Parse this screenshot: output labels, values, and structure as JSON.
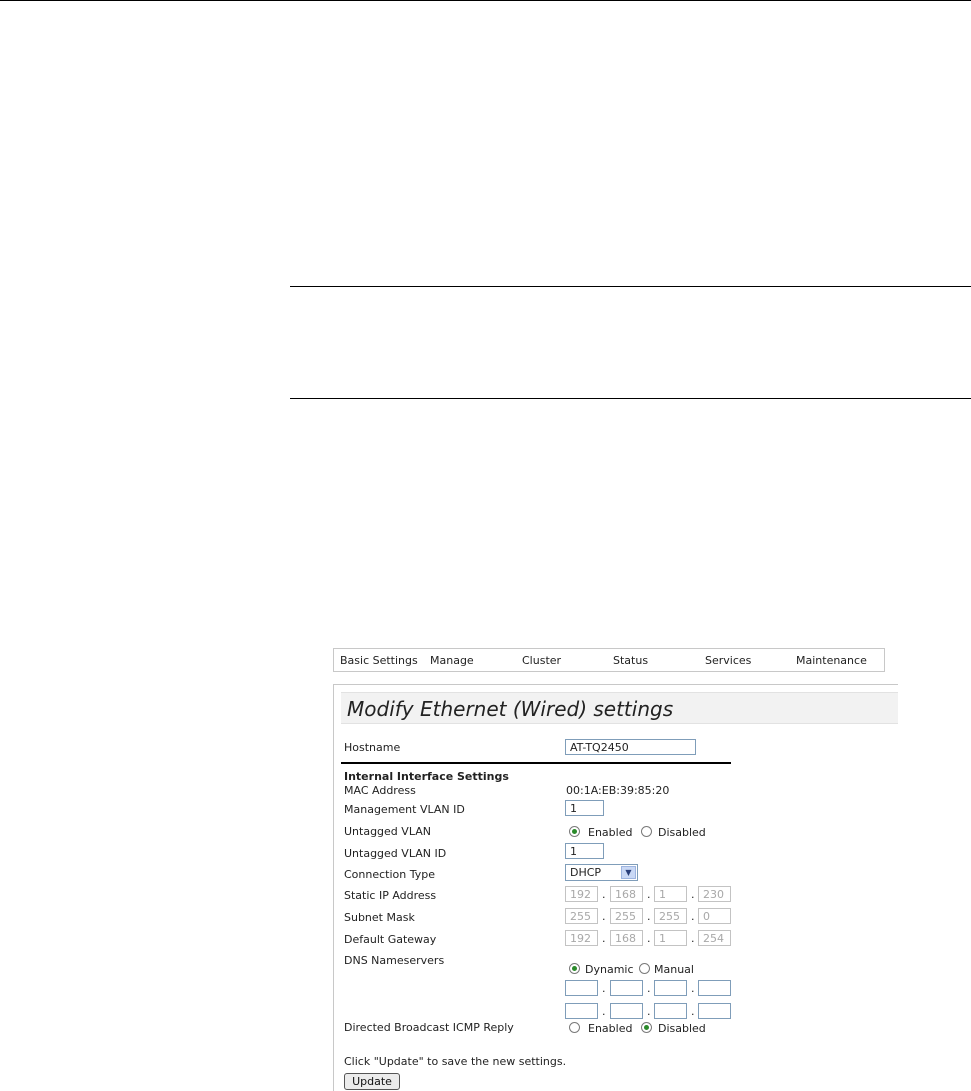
{
  "menu": {
    "items": [
      "Basic Settings",
      "Manage",
      "Cluster",
      "Status",
      "Services",
      "Maintenance"
    ]
  },
  "page": {
    "title": "Modify Ethernet (Wired) settings"
  },
  "form": {
    "hostname_label": "Hostname",
    "hostname_value": "AT-TQ2450",
    "section_heading": "Internal Interface Settings",
    "mac_label": "MAC Address",
    "mac_value": "00:1A:EB:39:85:20",
    "mgmt_vlan_label": "Management VLAN ID",
    "mgmt_vlan_value": "1",
    "untagged_vlan_label": "Untagged VLAN",
    "untagged_vlan_options": [
      "Enabled",
      "Disabled"
    ],
    "untagged_vlan_selected": "Enabled",
    "untagged_vlan_id_label": "Untagged VLAN ID",
    "untagged_vlan_id_value": "1",
    "connection_type_label": "Connection Type",
    "connection_type_value": "DHCP",
    "static_ip_label": "Static IP Address",
    "static_ip": [
      "192",
      "168",
      "1",
      "230"
    ],
    "subnet_label": "Subnet Mask",
    "subnet": [
      "255",
      "255",
      "255",
      "0"
    ],
    "gateway_label": "Default Gateway",
    "gateway": [
      "192",
      "168",
      "1",
      "254"
    ],
    "dns_label": "DNS Nameservers",
    "dns_options": [
      "Dynamic",
      "Manual"
    ],
    "dns_selected": "Dynamic",
    "dns1": [
      "",
      "",
      "",
      ""
    ],
    "dns2": [
      "",
      "",
      "",
      ""
    ],
    "icmp_label": "Directed Broadcast ICMP Reply",
    "icmp_options": [
      "Enabled",
      "Disabled"
    ],
    "icmp_selected": "Disabled",
    "save_hint": "Click \"Update\" to save the new settings.",
    "update_label": "Update"
  }
}
